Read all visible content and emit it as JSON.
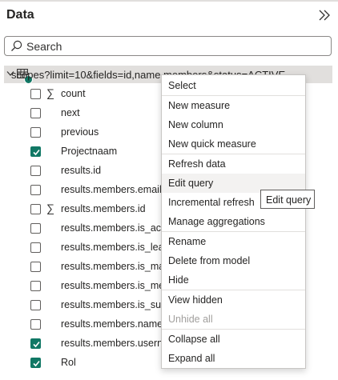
{
  "pane": {
    "title": "Data",
    "collapse_icon": "double-chevron-right-icon"
  },
  "search": {
    "placeholder": "Search",
    "icon": "search-icon"
  },
  "table": {
    "name": "scopes?limit=10&fields=id,name,members&status=ACTIVE",
    "icon": "table-icon",
    "badge_color": "#117865"
  },
  "fields": [
    {
      "name": "count",
      "checked": false,
      "sigma": true
    },
    {
      "name": "next",
      "checked": false,
      "sigma": false
    },
    {
      "name": "previous",
      "checked": false,
      "sigma": false
    },
    {
      "name": "Projectnaam",
      "checked": true,
      "sigma": false
    },
    {
      "name": "results.id",
      "checked": false,
      "sigma": false
    },
    {
      "name": "results.members.email",
      "checked": false,
      "sigma": false
    },
    {
      "name": "results.members.id",
      "checked": false,
      "sigma": true
    },
    {
      "name": "results.members.is_activ",
      "checked": false,
      "sigma": false
    },
    {
      "name": "results.members.is_lead",
      "checked": false,
      "sigma": false
    },
    {
      "name": "results.members.is_man",
      "checked": false,
      "sigma": false
    },
    {
      "name": "results.members.is_mem",
      "checked": false,
      "sigma": false
    },
    {
      "name": "results.members.is_supe",
      "checked": false,
      "sigma": false
    },
    {
      "name": "results.members.name",
      "checked": false,
      "sigma": false
    },
    {
      "name": "results.members.userna",
      "checked": true,
      "sigma": false
    },
    {
      "name": "Rol",
      "checked": true,
      "sigma": false
    }
  ],
  "context_menu": {
    "items": [
      {
        "label": "Select"
      },
      {
        "label": "New measure"
      },
      {
        "label": "New column"
      },
      {
        "label": "New quick measure"
      },
      {
        "label": "Refresh data"
      },
      {
        "label": "Edit query",
        "hover": true
      },
      {
        "label": "Incremental refresh"
      },
      {
        "label": "Manage aggregations"
      },
      {
        "label": "Rename"
      },
      {
        "label": "Delete from model"
      },
      {
        "label": "Hide"
      },
      {
        "label": "View hidden"
      },
      {
        "label": "Unhide all",
        "disabled": true
      },
      {
        "label": "Collapse all"
      },
      {
        "label": "Expand all"
      }
    ]
  },
  "tooltip": {
    "text": "Edit query"
  },
  "colors": {
    "accent": "#117865",
    "selected_row": "#e1dfdd",
    "hover_item": "#f3f2f1"
  }
}
